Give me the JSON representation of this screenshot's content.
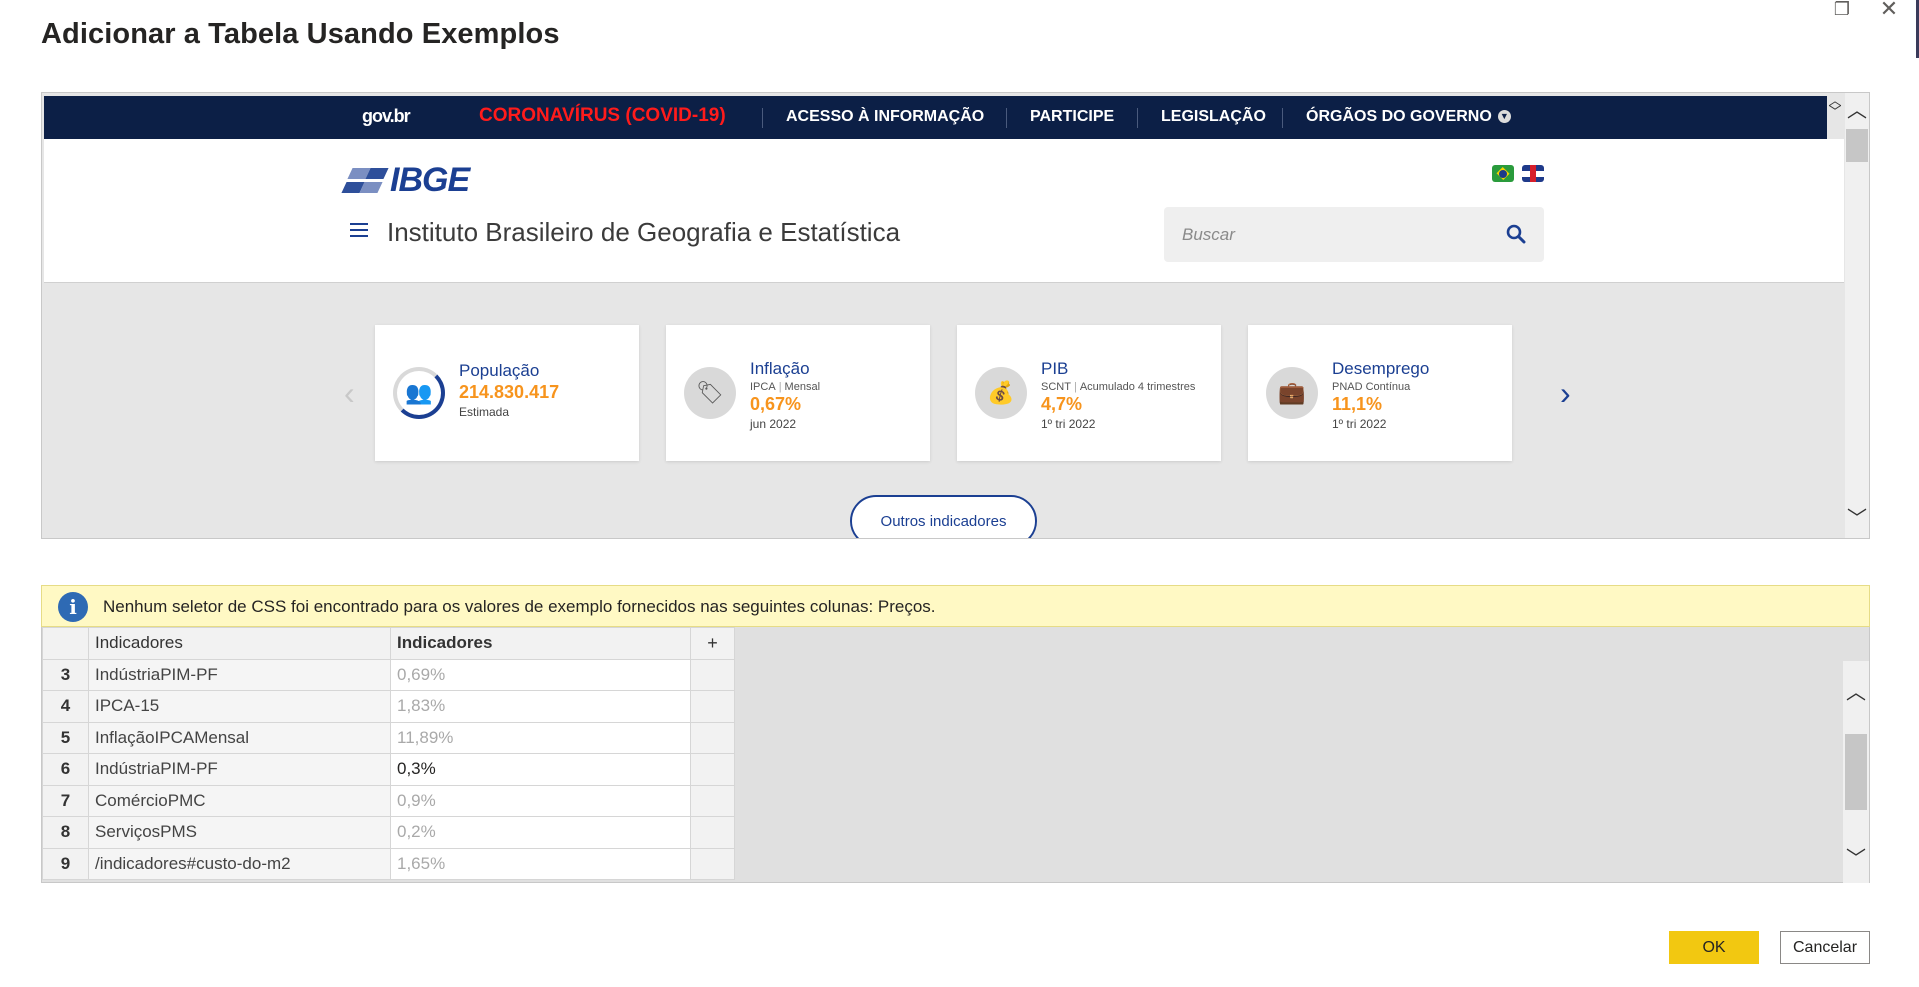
{
  "dialog": {
    "title": "Adicionar a Tabela Usando Exemplos",
    "ok_label": "OK",
    "cancel_label": "Cancelar"
  },
  "browser": {
    "topbar": {
      "brand": "gov.br",
      "links": [
        "CORONAVÍRUS (COVID-19)",
        "ACESSO À INFORMAÇÃO",
        "PARTICIPE",
        "LEGISLAÇÃO",
        "ÓRGÃOS DO GOVERNO"
      ],
      "covid_color": "#ff1b1b",
      "background": "#0c1f46"
    },
    "logo": "IBGE",
    "site_name": "Instituto Brasileiro de Geografia e Estatística",
    "search_placeholder": "Buscar",
    "cards": [
      {
        "icon": "people-icon",
        "title": "População",
        "sub": "",
        "sub2": "",
        "value": "214.830.417",
        "note": "Estimada"
      },
      {
        "icon": "price-tag-icon",
        "title": "Inflação",
        "sub": "IPCA",
        "sub2": "Mensal",
        "value": "0,67%",
        "note": "jun 2022"
      },
      {
        "icon": "money-bag-icon",
        "title": "PIB",
        "sub": "SCNT",
        "sub2": "Acumulado 4 trimestres",
        "value": "4,7%",
        "note": "1º tri 2022"
      },
      {
        "icon": "briefcase-icon",
        "title": "Desemprego",
        "sub": "PNAD Contínua",
        "sub2": "",
        "value": "11,1%",
        "note": "1º tri 2022"
      }
    ],
    "outros_label": "Outros indicadores",
    "accent": "#1b3f92",
    "value_color": "#f7941d"
  },
  "info": {
    "message": "Nenhum seletor de CSS foi encontrado para os valores de exemplo fornecidos nas seguintes colunas: Preços.",
    "background": "#fff9c4"
  },
  "grid": {
    "headers": [
      "Indicadores",
      "Indicadores",
      "+"
    ],
    "rows": [
      {
        "idx": "3",
        "col1": "IndústriaPIM-PF",
        "col2": "0,69%",
        "set": false
      },
      {
        "idx": "4",
        "col1": "IPCA-15",
        "col2": "1,83%",
        "set": false
      },
      {
        "idx": "5",
        "col1": "InflaçãoIPCAMensal",
        "col2": "11,89%",
        "set": false
      },
      {
        "idx": "6",
        "col1": "IndústriaPIM-PF",
        "col2": "0,3%",
        "set": true
      },
      {
        "idx": "7",
        "col1": "ComércioPMC",
        "col2": "0,9%",
        "set": false
      },
      {
        "idx": "8",
        "col1": "ServiçosPMS",
        "col2": "0,2%",
        "set": false
      },
      {
        "idx": "9",
        "col1": "/indicadores#custo-do-m2",
        "col2": "1,65%",
        "set": false
      }
    ]
  },
  "ok_color": "#f2c811"
}
